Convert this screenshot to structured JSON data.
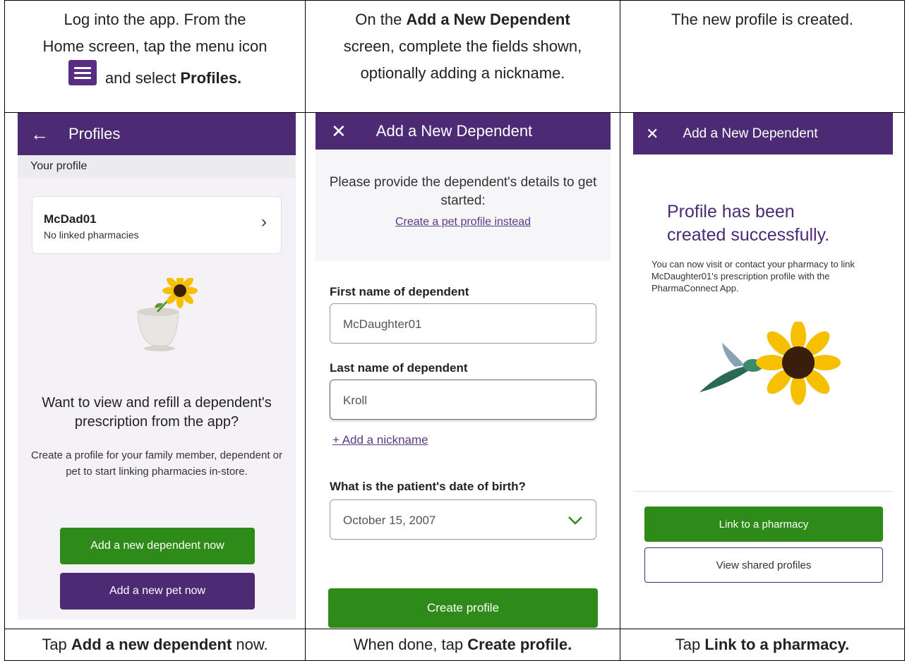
{
  "instructions": {
    "col1": {
      "line1": "Log into the app.  From the",
      "line2": "Home screen, tap the menu icon",
      "line3_tail": "and select",
      "line3_bold": "Profiles."
    },
    "col2": {
      "pre": "On the",
      "bold": "Add a New Dependent",
      "line2": "screen, complete the fields shown,",
      "line3": "optionally adding a nickname."
    },
    "col3": {
      "text": "The new profile is created."
    }
  },
  "captions": {
    "col1": {
      "pre": "Tap",
      "bold": "Add a new dependent",
      "post": "now."
    },
    "col2": {
      "pre": "When done, tap",
      "bold": "Create profile."
    },
    "col3": {
      "pre": "Tap",
      "bold": "Link to a pharmacy."
    }
  },
  "screen1": {
    "title": "Profiles",
    "back_icon": "←",
    "section": "Your profile",
    "profile_name": "McDad01",
    "profile_sub": "No linked pharmacies",
    "question": "Want to view and refill a dependent's prescription from the app?",
    "desc": "Create a profile for your family member, dependent or pet to start linking pharmacies in-store.",
    "btn_dependent": "Add a new dependent now",
    "btn_pet": "Add a new pet now",
    "icons": [
      "back-arrow",
      "chevron-right",
      "sunflower-mortar-illustration"
    ]
  },
  "screen2": {
    "title": "Add a New Dependent",
    "close_icon": "✕",
    "intro": "Please provide the dependent's details to get started:",
    "pet_link": "Create a pet profile instead",
    "first_label": "First name of dependent",
    "first_value": "McDaughter01",
    "last_label": "Last name of dependent",
    "last_value": "Kroll",
    "nickname_link": "+ Add a nickname",
    "dob_label": "What is the patient's date of birth?",
    "dob_value": "October 15, 2007",
    "create_btn": "Create profile"
  },
  "screen3": {
    "title": "Add a New Dependent",
    "close_icon": "✕",
    "heading": "Profile has been created successfully.",
    "body": "You can now visit or contact your pharmacy to link McDaughter01's prescription profile with the PharmaConnect App.",
    "btn_link": "Link to a pharmacy",
    "btn_view": "View shared profiles"
  },
  "colors": {
    "brand_purple": "#4c2a74",
    "action_green": "#2e8b1a",
    "link_purple": "#5b3a86"
  }
}
